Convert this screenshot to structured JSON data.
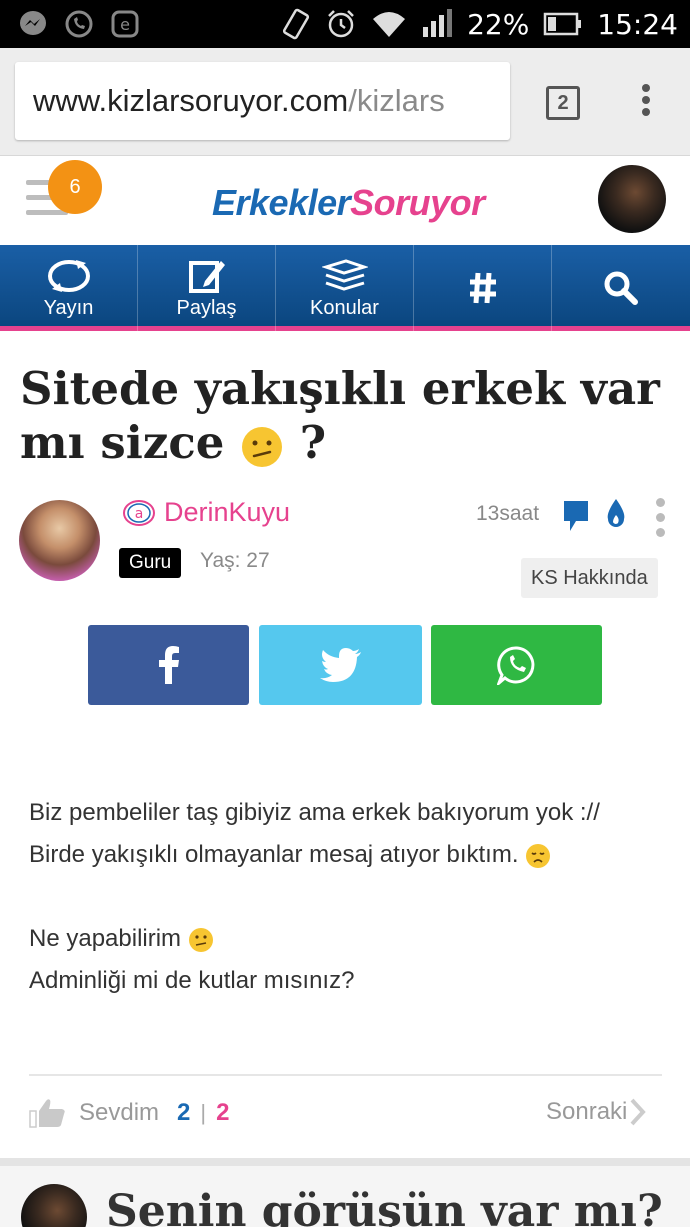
{
  "status_bar": {
    "battery": "22%",
    "time": "15:24",
    "left_icons": [
      "messenger-icon",
      "whatsapp-icon",
      "e-icon"
    ],
    "right_icons": [
      "rotate-icon",
      "alarm-icon",
      "wifi-icon",
      "signal-icon",
      "battery-icon"
    ]
  },
  "browser": {
    "url_host": "www.kizlarsoruyor.com",
    "url_path": "/kizlars",
    "tab_count": "2"
  },
  "site": {
    "notification_count": "6",
    "logo_part1": "Erkekler",
    "logo_part2": "Soruyor",
    "accent_blue": "#1a69b3",
    "accent_pink": "#e6428e"
  },
  "nav": [
    {
      "label": "Yayın",
      "icon": "refresh-icon"
    },
    {
      "label": "Paylaş",
      "icon": "edit-icon"
    },
    {
      "label": "Konular",
      "icon": "books-icon"
    },
    {
      "label": "",
      "icon": "hashtag-icon"
    },
    {
      "label": "",
      "icon": "search-icon"
    }
  ],
  "question": {
    "title": "Sitede yakışıklı erkek var mı sizce",
    "title_suffix": "?",
    "author": "DerinKuyu",
    "author_badge": "Guru",
    "author_age": "Yaş: 27",
    "time": "13saat",
    "topic": "KS Hakkında",
    "body": {
      "line1": "Biz pembeliler taş gibiyiz ama erkek bakıyorum yok :// Birde yakışıklı olmayanlar mesaj atıyor bıktım.",
      "line2": "Ne yapabilirim",
      "line3": "Adminliği mi de kutlar mısınız?"
    }
  },
  "reactions": {
    "like_label": "Sevdim",
    "count_blue": "2",
    "separator": "|",
    "count_pink": "2",
    "next_label": "Sonraki"
  },
  "bottom": {
    "title": "Senin görüşün var mı?"
  }
}
